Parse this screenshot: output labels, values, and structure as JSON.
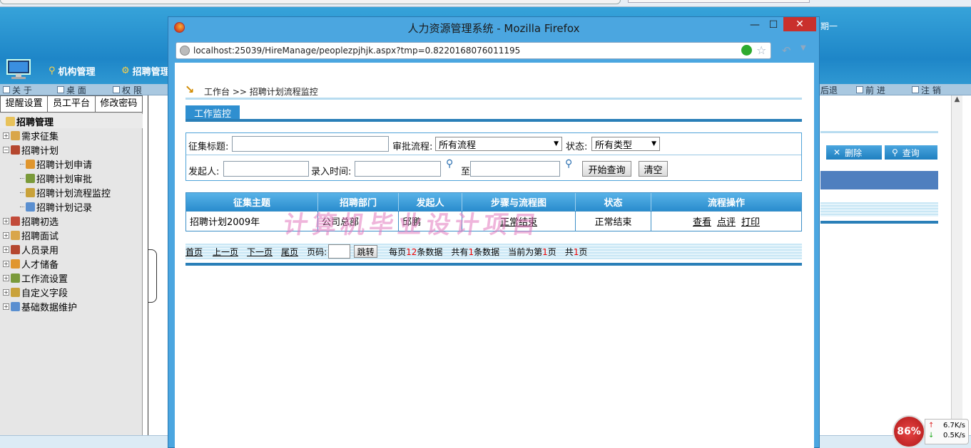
{
  "background": {
    "nav": [
      {
        "label": "机构管理"
      },
      {
        "label": "招聘管理"
      }
    ],
    "toolbar": [
      {
        "label": "关 于"
      },
      {
        "label": "桌 面"
      },
      {
        "label": "权 限"
      },
      {
        "label": "后退"
      },
      {
        "label": "前 进"
      },
      {
        "label": "注 销"
      }
    ],
    "header_date_fragment": "期一",
    "user_panel": [
      "提醒设置",
      "员工平台",
      "修改密码"
    ],
    "sidebar": {
      "title": "招聘管理",
      "items": [
        {
          "label": "需求征集",
          "level": 1
        },
        {
          "label": "招聘计划",
          "level": 1
        },
        {
          "label": "招聘计划申请",
          "level": 2
        },
        {
          "label": "招聘计划审批",
          "level": 2
        },
        {
          "label": "招聘计划流程监控",
          "level": 2
        },
        {
          "label": "招聘计划记录",
          "level": 2
        },
        {
          "label": "招聘初选",
          "level": 1
        },
        {
          "label": "招聘面试",
          "level": 1
        },
        {
          "label": "人员录用",
          "level": 1
        },
        {
          "label": "人才储备",
          "level": 1
        },
        {
          "label": "工作流设置",
          "level": 1
        },
        {
          "label": "自定义字段",
          "level": 1
        },
        {
          "label": "基础数据维护",
          "level": 1
        }
      ]
    },
    "right_buttons": {
      "delete": "删除",
      "query": "查询"
    },
    "net_monitor": {
      "percent": "86%",
      "up": "6.7K/s",
      "down": "0.5K/s"
    }
  },
  "popup": {
    "title": "人力资源管理系统 - Mozilla Firefox",
    "controls": {
      "minimize": "—",
      "maximize": "☐",
      "close": "✕"
    },
    "url": "localhost:25039/HireManage/peoplezpjhjk.aspx?tmp=0.8220168076011195",
    "breadcrumb": "工作台 >> 招聘计划流程监控",
    "tab": "工作监控",
    "filters": {
      "title_label": "征集标题:",
      "title_value": "",
      "flow_label": "审批流程:",
      "flow_value": "所有流程",
      "status_label": "状态:",
      "status_value": "所有类型",
      "initiator_label": "发起人:",
      "initiator_value": "",
      "time_label": "录入时间:",
      "time_from": "",
      "to_label": "至",
      "time_to": "",
      "search_button": "开始查询",
      "clear_button": "清空"
    },
    "table": {
      "headers": [
        "征集主题",
        "招聘部门",
        "发起人",
        "步骤与流程图",
        "状态",
        "流程操作"
      ],
      "rows": [
        {
          "subject": "招聘计划2009年",
          "dept": "公司总部",
          "initiator": "邱鹏",
          "step": "正常结束",
          "status": "正常结束",
          "ops": [
            "查看",
            "点评",
            "打印"
          ]
        }
      ]
    },
    "pager": {
      "first": "首页",
      "prev": "上一页",
      "next": "下一页",
      "last": "尾页",
      "page_label": "页码:",
      "page_value": "",
      "jump": "跳转",
      "per_page_pre": "每页",
      "per_page": "12",
      "per_page_post": "条数据",
      "total_pre": "共有",
      "total": "1",
      "total_post": "条数据",
      "current_pre": "当前为第",
      "current": "1",
      "current_post": "页",
      "pages_pre": "共",
      "pages": "1",
      "pages_post": "页"
    },
    "watermark": "计算机毕业设计项目"
  }
}
